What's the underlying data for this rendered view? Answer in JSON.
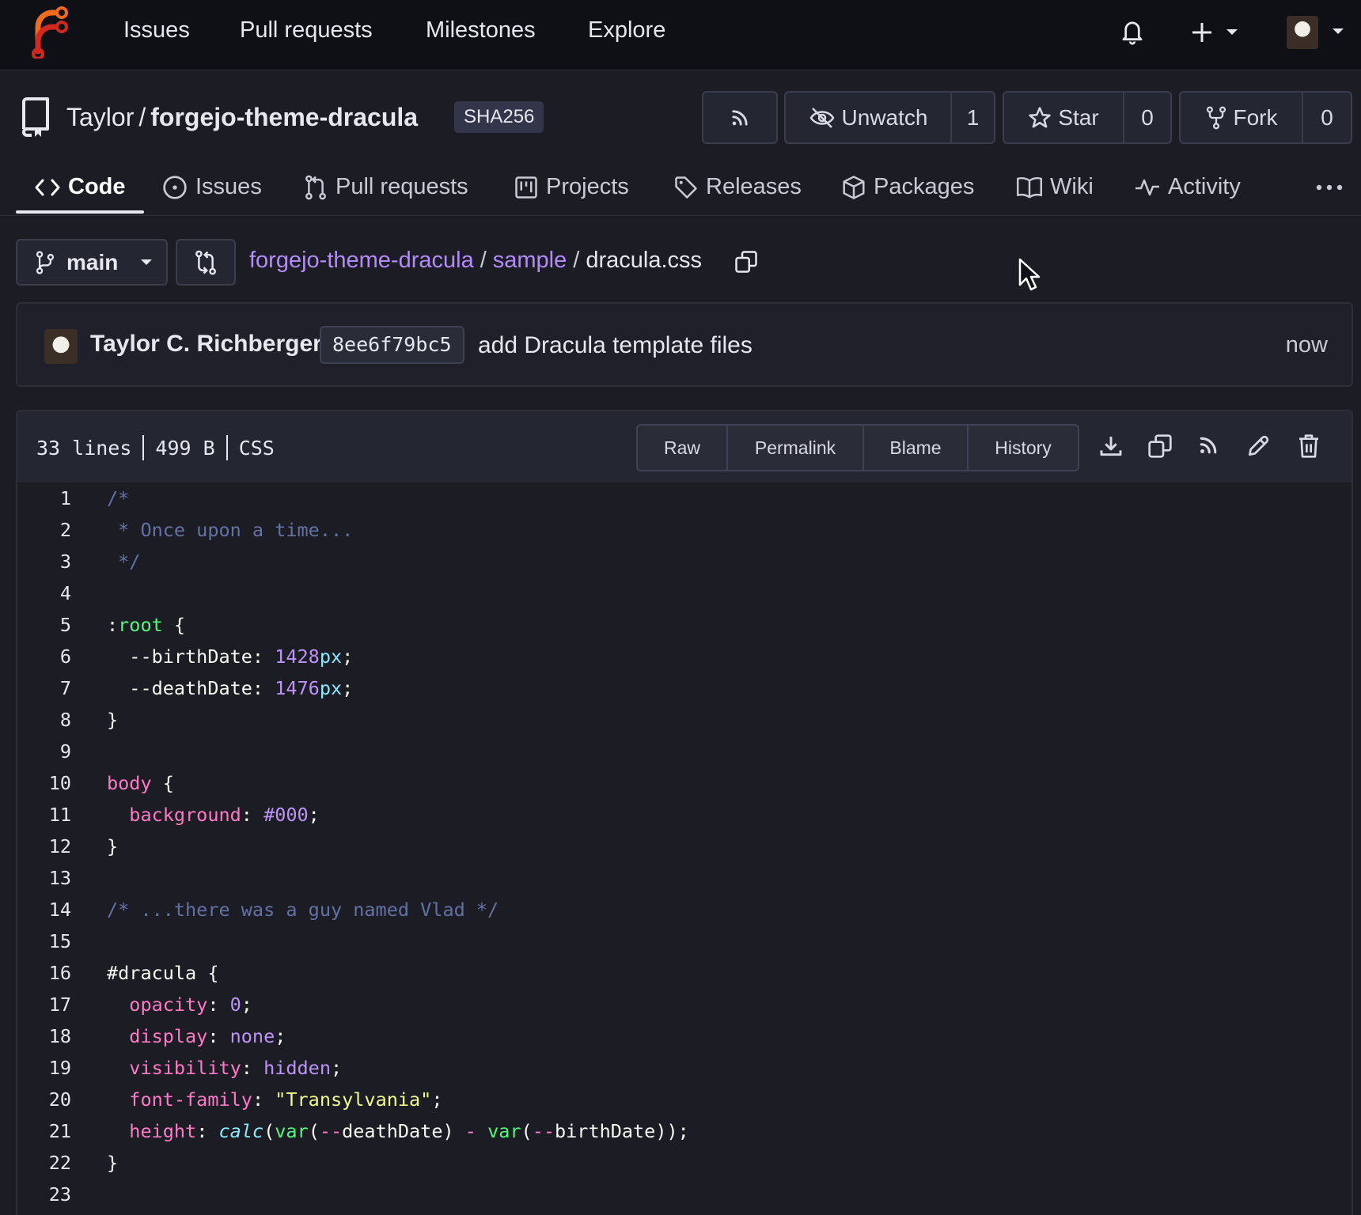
{
  "topnav": {
    "links": [
      "Issues",
      "Pull requests",
      "Milestones",
      "Explore"
    ]
  },
  "repo": {
    "owner": "Taylor",
    "separator": "/",
    "name": "forgejo-theme-dracula",
    "badge": "SHA256",
    "unwatch_label": "Unwatch",
    "watch_count": "1",
    "star_label": "Star",
    "star_count": "0",
    "fork_label": "Fork",
    "fork_count": "0"
  },
  "tabs": [
    "Code",
    "Issues",
    "Pull requests",
    "Projects",
    "Releases",
    "Packages",
    "Wiki",
    "Activity"
  ],
  "branch": {
    "name": "main"
  },
  "breadcrumb": {
    "root": "forgejo-theme-dracula",
    "folder": "sample",
    "file": "dracula.css",
    "sep": "/"
  },
  "commit": {
    "author": "Taylor C. Richberger",
    "sha": "8ee6f79bc5",
    "message": "add Dracula template files",
    "time": "now"
  },
  "file": {
    "lines": "33 lines",
    "size": "499 B",
    "language": "CSS",
    "buttons": [
      "Raw",
      "Permalink",
      "Blame",
      "History"
    ]
  },
  "code": [
    {
      "n": "1",
      "t": [
        [
          "comment",
          "/*"
        ]
      ]
    },
    {
      "n": "2",
      "t": [
        [
          "comment",
          " * Once upon a time..."
        ]
      ]
    },
    {
      "n": "3",
      "t": [
        [
          "comment",
          " */"
        ]
      ]
    },
    {
      "n": "4",
      "t": []
    },
    {
      "n": "5",
      "t": [
        [
          "punc",
          ":"
        ],
        [
          "pseudo",
          "root"
        ],
        [
          "punc",
          " {"
        ]
      ]
    },
    {
      "n": "6",
      "t": [
        [
          "punc",
          "  --birthDate: "
        ],
        [
          "num",
          "1428"
        ],
        [
          "unit",
          "px"
        ],
        [
          "punc",
          ";"
        ]
      ]
    },
    {
      "n": "7",
      "t": [
        [
          "punc",
          "  --deathDate: "
        ],
        [
          "num",
          "1476"
        ],
        [
          "unit",
          "px"
        ],
        [
          "punc",
          ";"
        ]
      ]
    },
    {
      "n": "8",
      "t": [
        [
          "punc",
          "}"
        ]
      ]
    },
    {
      "n": "9",
      "t": []
    },
    {
      "n": "10",
      "t": [
        [
          "tag",
          "body"
        ],
        [
          "punc",
          " {"
        ]
      ]
    },
    {
      "n": "11",
      "t": [
        [
          "punc",
          "  "
        ],
        [
          "prop",
          "background"
        ],
        [
          "punc",
          ": "
        ],
        [
          "num",
          "#000"
        ],
        [
          "punc",
          ";"
        ]
      ]
    },
    {
      "n": "12",
      "t": [
        [
          "punc",
          "}"
        ]
      ]
    },
    {
      "n": "13",
      "t": []
    },
    {
      "n": "14",
      "t": [
        [
          "comment",
          "/* ...there was a guy named Vlad */"
        ]
      ]
    },
    {
      "n": "15",
      "t": []
    },
    {
      "n": "16",
      "t": [
        [
          "punc",
          "#dracula {"
        ]
      ]
    },
    {
      "n": "17",
      "t": [
        [
          "punc",
          "  "
        ],
        [
          "prop",
          "opacity"
        ],
        [
          "punc",
          ": "
        ],
        [
          "num",
          "0"
        ],
        [
          "punc",
          ";"
        ]
      ]
    },
    {
      "n": "18",
      "t": [
        [
          "punc",
          "  "
        ],
        [
          "prop",
          "display"
        ],
        [
          "punc",
          ": "
        ],
        [
          "kw",
          "none"
        ],
        [
          "punc",
          ";"
        ]
      ]
    },
    {
      "n": "19",
      "t": [
        [
          "punc",
          "  "
        ],
        [
          "prop",
          "visibility"
        ],
        [
          "punc",
          ": "
        ],
        [
          "kw",
          "hidden"
        ],
        [
          "punc",
          ";"
        ]
      ]
    },
    {
      "n": "20",
      "t": [
        [
          "punc",
          "  "
        ],
        [
          "prop",
          "font-family"
        ],
        [
          "punc",
          ": "
        ],
        [
          "str",
          "\"Transylvania\""
        ],
        [
          "punc",
          ";"
        ]
      ]
    },
    {
      "n": "21",
      "t": [
        [
          "punc",
          "  "
        ],
        [
          "prop",
          "height"
        ],
        [
          "punc",
          ": "
        ],
        [
          "fn",
          "calc"
        ],
        [
          "punc",
          "("
        ],
        [
          "var",
          "var"
        ],
        [
          "punc",
          "("
        ],
        [
          "op",
          "--"
        ],
        [
          "punc",
          "deathDate) "
        ],
        [
          "op",
          "-"
        ],
        [
          "punc",
          " "
        ],
        [
          "var",
          "var"
        ],
        [
          "punc",
          "("
        ],
        [
          "op",
          "--"
        ],
        [
          "punc",
          "birthDate));"
        ]
      ]
    },
    {
      "n": "22",
      "t": [
        [
          "punc",
          "}"
        ]
      ]
    },
    {
      "n": "23",
      "t": []
    }
  ]
}
